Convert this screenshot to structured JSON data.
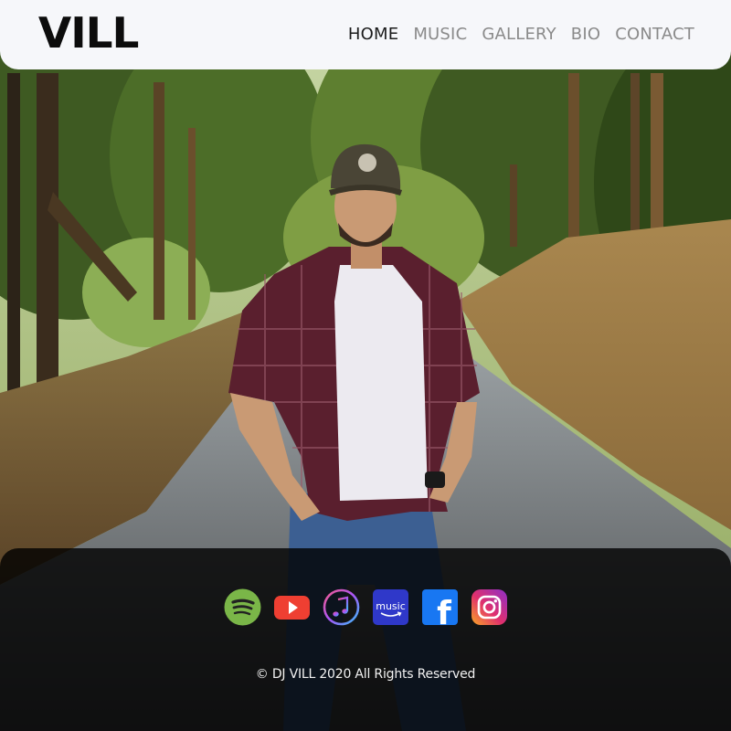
{
  "header": {
    "logo": "VILL",
    "nav": [
      {
        "label": "HOME",
        "active": true
      },
      {
        "label": "MUSIC",
        "active": false
      },
      {
        "label": "GALLERY",
        "active": false
      },
      {
        "label": "BIO",
        "active": false
      },
      {
        "label": "CONTACT",
        "active": false
      }
    ]
  },
  "footer": {
    "socials": [
      {
        "name": "spotify-icon",
        "color": "#7ab648"
      },
      {
        "name": "youtube-icon",
        "color": "#ef3f32"
      },
      {
        "name": "apple-music-icon",
        "color": "#f25a8a"
      },
      {
        "name": "amazon-music-icon",
        "color": "#2f38c9",
        "text": "music"
      },
      {
        "name": "facebook-icon",
        "color": "#1877f2",
        "text": "f"
      },
      {
        "name": "instagram-icon",
        "color": "#e1306c"
      }
    ],
    "copyright": "© DJ VILL 2020 All Rights Reserved"
  },
  "colors": {
    "header_bg": "#f6f7fa",
    "nav_active": "#1c1c1c",
    "nav_inactive": "#8a8a8a",
    "footer_bg": "rgba(0,0,0,0.80)"
  }
}
